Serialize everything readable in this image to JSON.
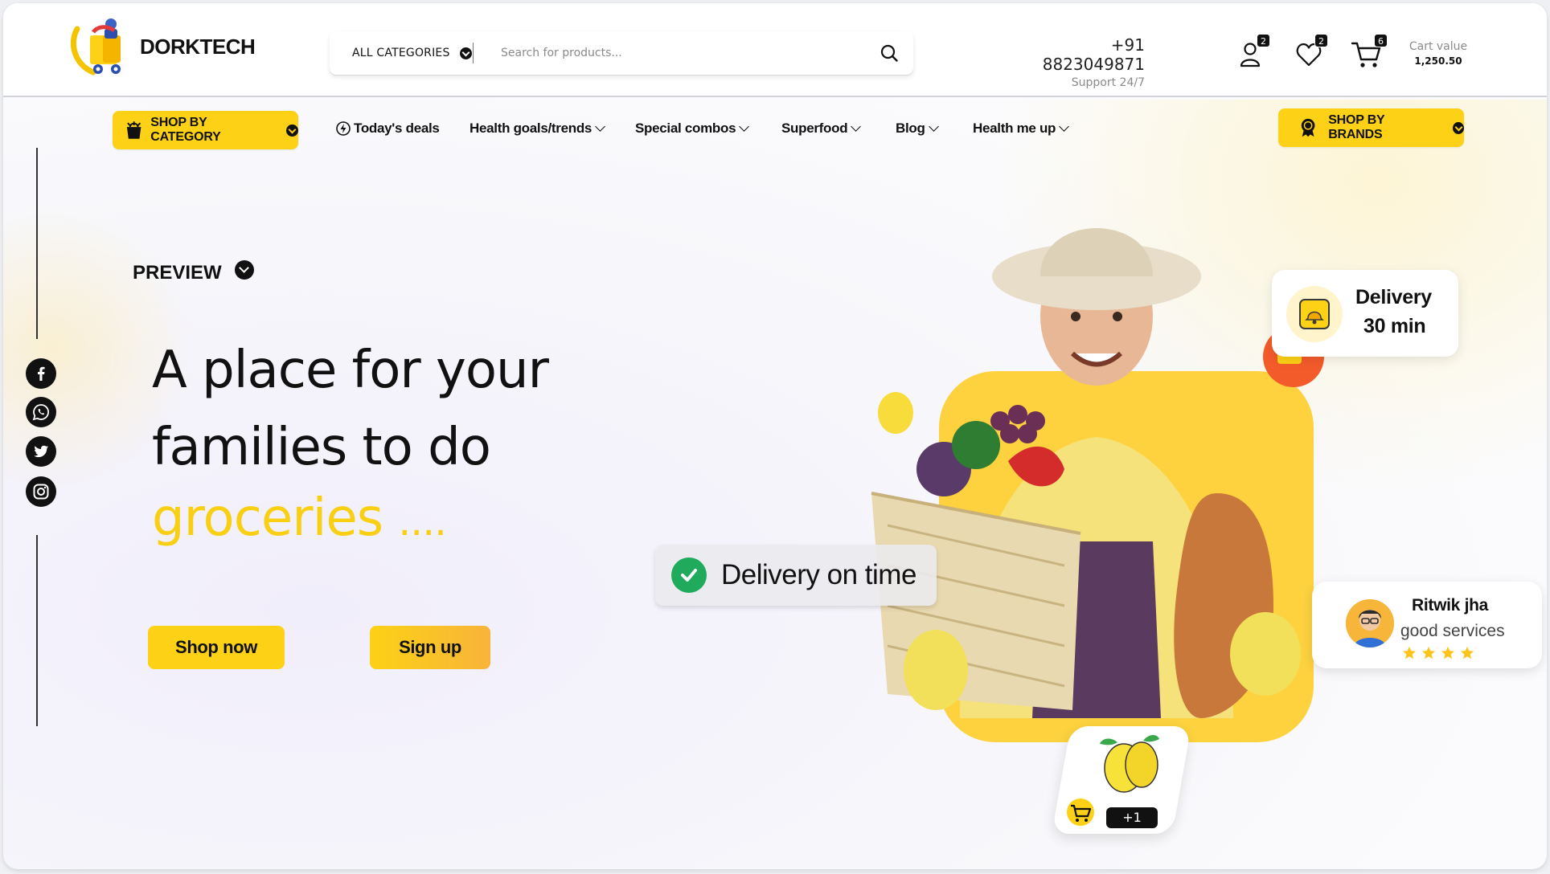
{
  "brand": {
    "name": "DORKTECH"
  },
  "search": {
    "category_label": "ALL CATEGORIES",
    "placeholder": "Search for products..."
  },
  "contact": {
    "phone": "+91 8823049871",
    "support": "Support 24/7"
  },
  "header_icons": {
    "account_badge": "2",
    "wishlist_badge": "2",
    "cart_badge": "6"
  },
  "cart": {
    "label": "Cart value",
    "value": "1,250.50"
  },
  "nav": {
    "shop_by_category": "SHOP BY CATEGORY",
    "items": [
      {
        "label": "Today's deals",
        "icon": "lightning-icon",
        "has_dropdown": false
      },
      {
        "label": "Health goals/trends",
        "has_dropdown": true
      },
      {
        "label": "Special combos",
        "has_dropdown": true
      },
      {
        "label": "Superfood",
        "has_dropdown": true
      },
      {
        "label": "Blog",
        "has_dropdown": true
      },
      {
        "label": "Health me up",
        "has_dropdown": true
      }
    ],
    "shop_by_brands": "SHOP BY BRANDS"
  },
  "social": [
    "facebook-icon",
    "whatsapp-icon",
    "twitter-icon",
    "instagram-icon"
  ],
  "hero": {
    "preview_label": "PREVIEW",
    "line1": "A place for your",
    "line2": "families to do",
    "line3": "groceries",
    "line3_suffix": "....",
    "shop_now": "Shop now",
    "sign_up": "Sign up"
  },
  "badges": {
    "delivery_on_time": "Delivery on time",
    "delivery_title": "Delivery",
    "delivery_time": "30 min",
    "reviewer_name": "Ritwik jha",
    "review_text": "good services",
    "review_stars": 4,
    "add_count": "+1"
  },
  "colors": {
    "accent": "#fcd116",
    "success": "#1faa5c",
    "text": "#111111"
  }
}
